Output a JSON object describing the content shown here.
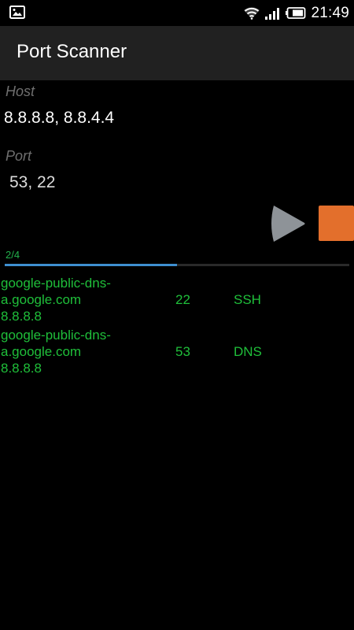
{
  "status_bar": {
    "time": "21:49",
    "left_icon": "image-icon",
    "icons": [
      "wifi-icon",
      "signal-icon",
      "battery-icon"
    ]
  },
  "app": {
    "title": "Port Scanner"
  },
  "form": {
    "host_label": "Host",
    "host_value": "8.8.8.8, 8.8.4.4",
    "port_label": "Port",
    "port_value": "53, 22"
  },
  "controls": {
    "play_icon": "play-icon",
    "stop_icon": "stop-icon",
    "stop_color": "#e36f2c",
    "play_color": "#8e9398"
  },
  "progress": {
    "text": "2/4",
    "fraction": 0.5,
    "color": "#3e8fd0"
  },
  "results": [
    {
      "host_line1": "google-public-dns-",
      "host_line2": "a.google.com",
      "ip": "8.8.8.8",
      "port": "22",
      "service": "SSH"
    },
    {
      "host_line1": "google-public-dns-",
      "host_line2": "a.google.com",
      "ip": "8.8.8.8",
      "port": "53",
      "service": "DNS"
    }
  ],
  "colors": {
    "result_text": "#1fbf3a",
    "app_bar": "#212121",
    "background": "#000000"
  }
}
